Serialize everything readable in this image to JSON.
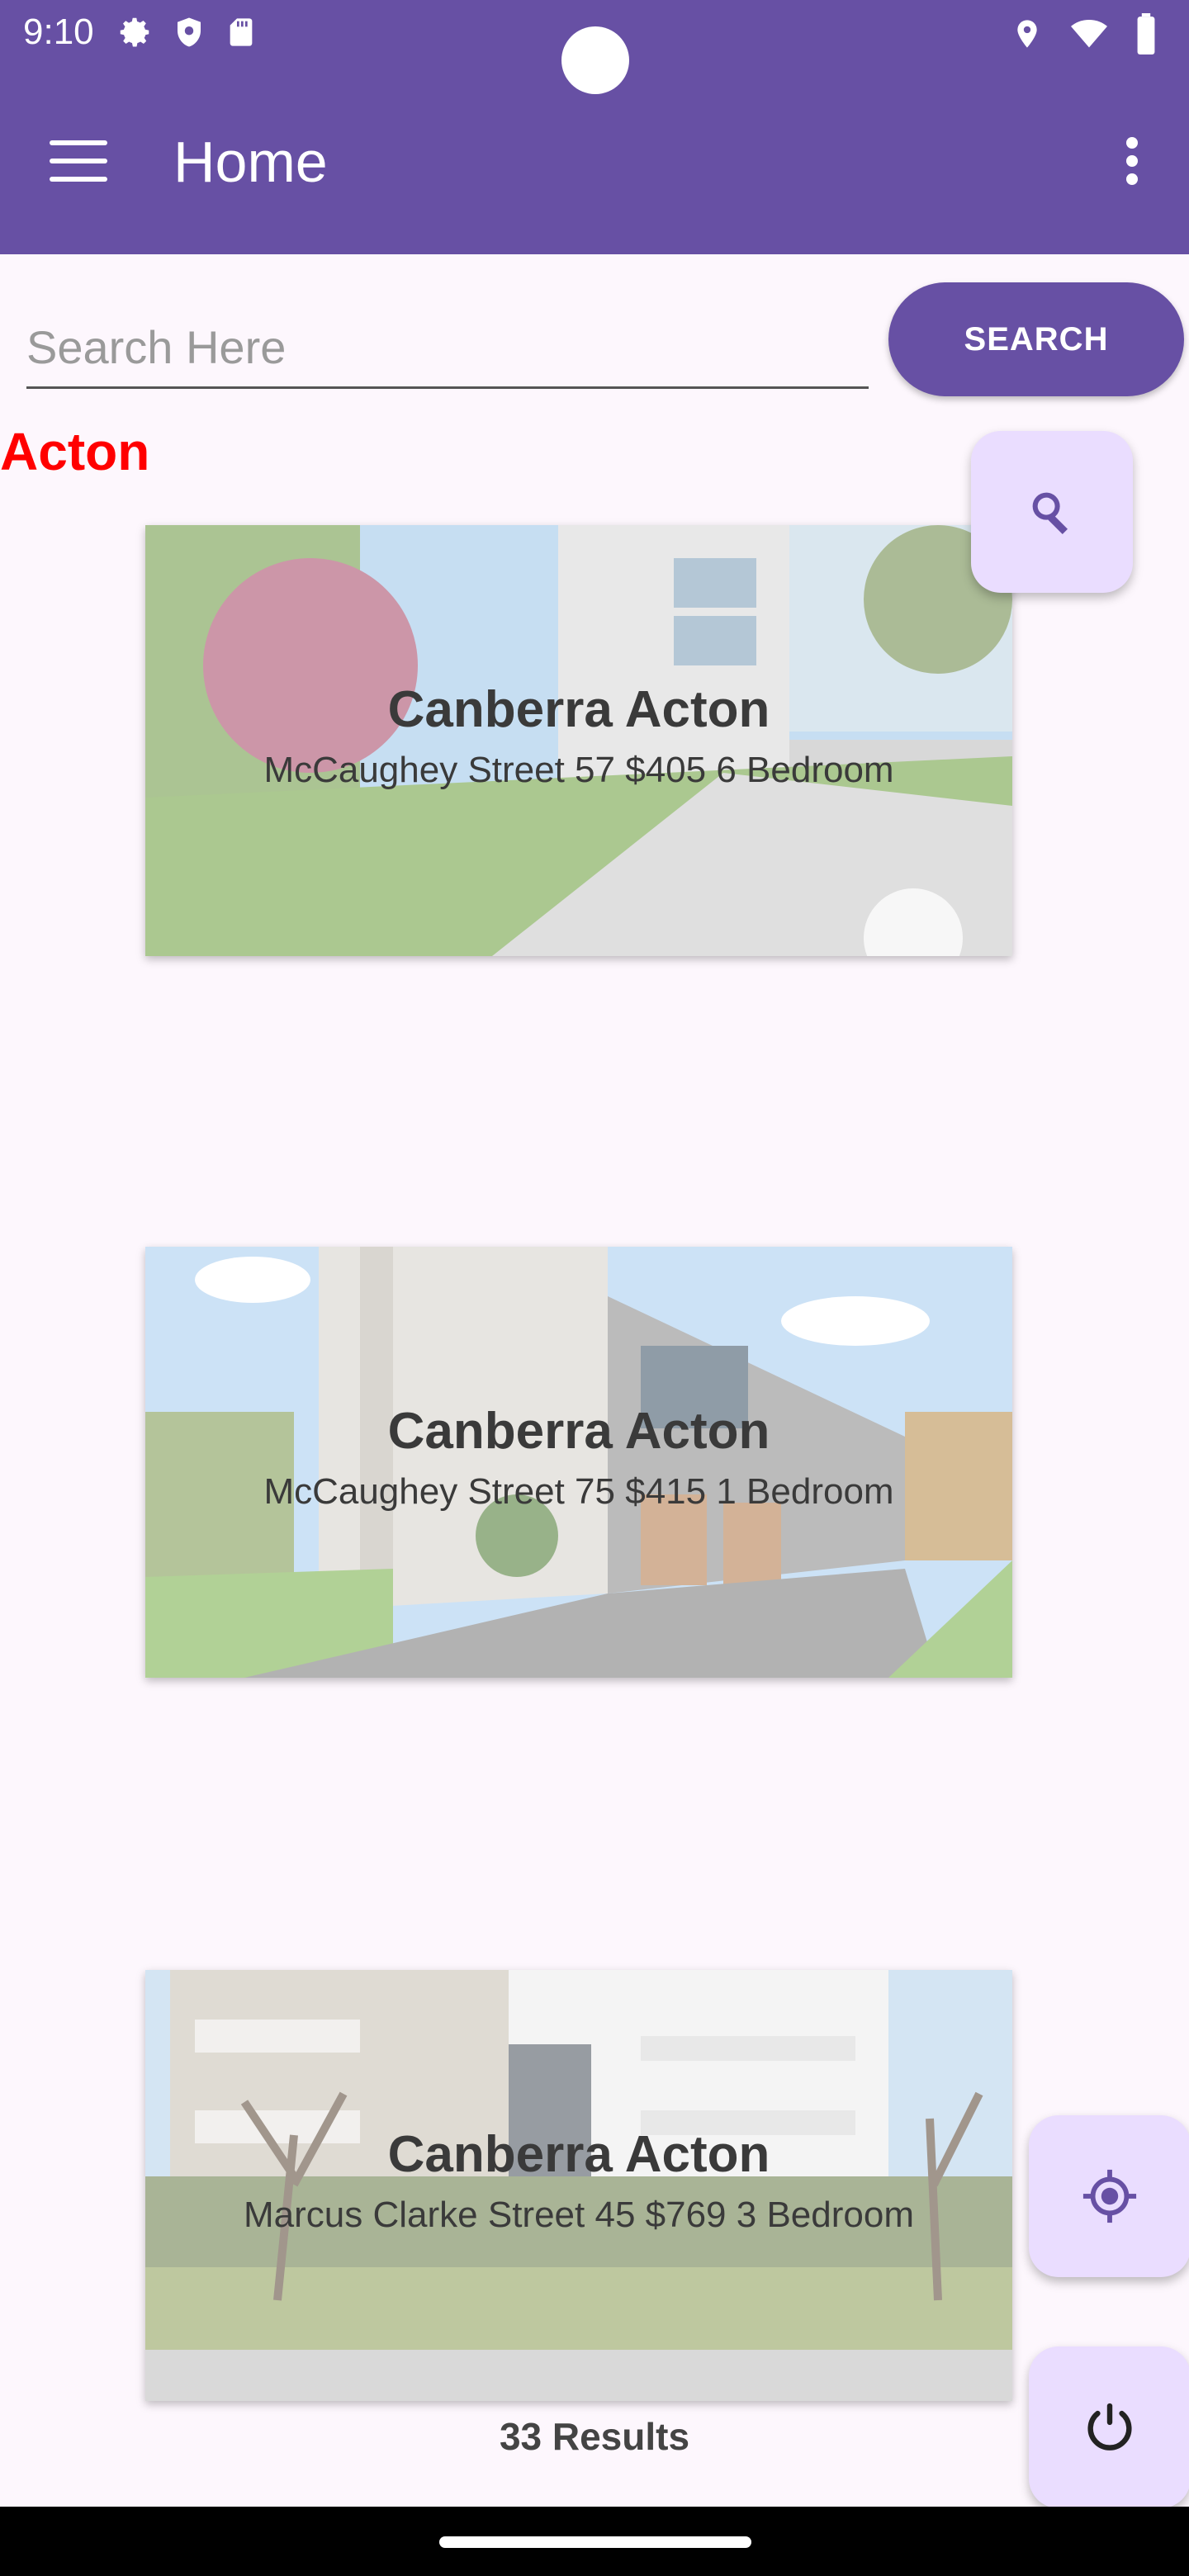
{
  "status_bar": {
    "time": "9:10",
    "left_icons": [
      "gear-icon",
      "shield-icon",
      "sd-card-icon"
    ],
    "right_icons": [
      "location-icon",
      "wifi-icon",
      "battery-icon"
    ]
  },
  "app_bar": {
    "title": "Home",
    "menu_icon": "hamburger-menu-icon",
    "overflow_icon": "more-vertical-icon",
    "color": "#6750a4"
  },
  "search": {
    "placeholder": "Search Here",
    "value": "",
    "button_label": "SEARCH"
  },
  "section": {
    "heading": "Acton",
    "heading_color": "#ff0000"
  },
  "listings": [
    {
      "title": "Canberra Acton",
      "subtitle": "McCaughey Street 57 $405 6 Bedroom"
    },
    {
      "title": "Canberra Acton",
      "subtitle": "McCaughey Street 75 $415 1 Bedroom"
    },
    {
      "title": "Canberra Acton",
      "subtitle": "Marcus Clarke Street 45 $769 3 Bedroom"
    }
  ],
  "fabs": {
    "search_icon": "magnifier-icon",
    "locate_icon": "crosshair-location-icon",
    "power_icon": "power-icon",
    "background": "#eaddff"
  },
  "footer": {
    "results": "33 Results"
  }
}
